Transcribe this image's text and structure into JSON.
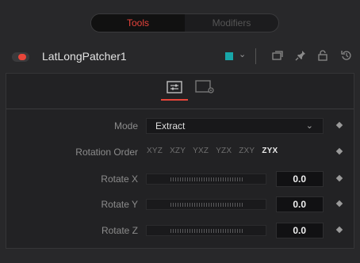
{
  "tabs": {
    "tools": "Tools",
    "modifiers": "Modifiers"
  },
  "tool": {
    "name": "LatLongPatcher1",
    "color": "#18a6a8"
  },
  "panel": {
    "mode": {
      "label": "Mode",
      "value": "Extract"
    },
    "rotation_order": {
      "label": "Rotation Order",
      "options": [
        "XYZ",
        "XZY",
        "YXZ",
        "YZX",
        "ZXY",
        "ZYX"
      ],
      "selected": "ZYX"
    },
    "rotate_x": {
      "label": "Rotate X",
      "value": "0.0"
    },
    "rotate_y": {
      "label": "Rotate Y",
      "value": "0.0"
    },
    "rotate_z": {
      "label": "Rotate Z",
      "value": "0.0"
    }
  },
  "icons": {
    "header": [
      "active-toggle",
      "color-swatch",
      "collapse-icon",
      "pin-icon",
      "lock-icon",
      "reset-icon"
    ],
    "panel_tabs": [
      "controls-icon",
      "settings-icon"
    ]
  }
}
